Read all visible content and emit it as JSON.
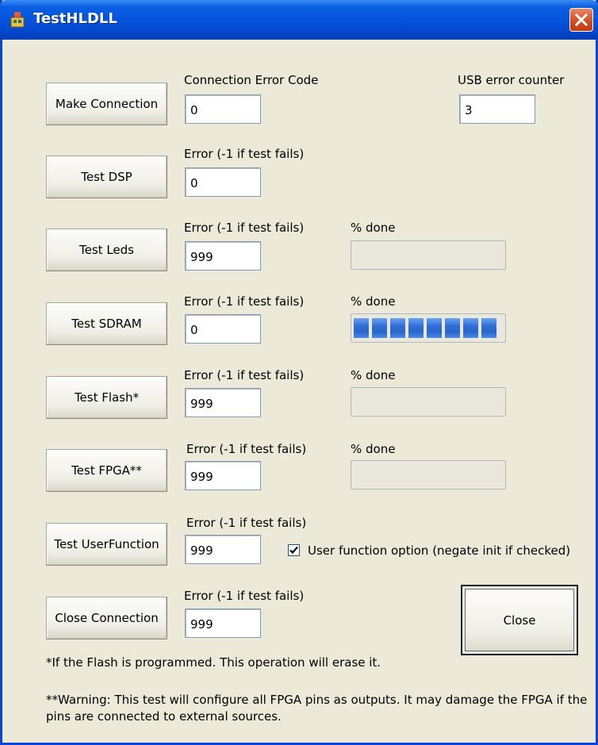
{
  "window": {
    "title": "TestHLDLL"
  },
  "labels": {
    "connection_error_code": "Connection Error Code",
    "usb_error_counter": "USB error counter",
    "error_fail": "Error (-1 if test fails)",
    "percent_done": "% done"
  },
  "buttons": {
    "make_connection": "Make Connection",
    "test_dsp": "Test DSP",
    "test_leds": "Test Leds",
    "test_sdram": "Test SDRAM",
    "test_flash": "Test Flash*",
    "test_fpga": "Test FPGA**",
    "test_userfunction": "Test UserFunction",
    "close_connection": "Close Connection",
    "close": "Close"
  },
  "fields": {
    "connection_error_code": "0",
    "usb_error_counter": "3",
    "dsp_error": "0",
    "leds_error": "999",
    "sdram_error": "0",
    "flash_error": "999",
    "fpga_error": "999",
    "userfunction_error": "999",
    "close_error": "999"
  },
  "progress": {
    "leds": 0,
    "sdram": 100,
    "flash": 0,
    "fpga": 0
  },
  "checkbox": {
    "label": "User function option (negate init if checked)",
    "checked": true
  },
  "notes": {
    "flash": "*If the Flash is programmed. This operation will erase it.",
    "fpga": "**Warning: This test will configure all FPGA pins as outputs. It may damage the FPGA if the pins are connected to external sources."
  },
  "icons": {
    "app": "app-icon",
    "close": "close-icon",
    "check": "check-icon"
  }
}
